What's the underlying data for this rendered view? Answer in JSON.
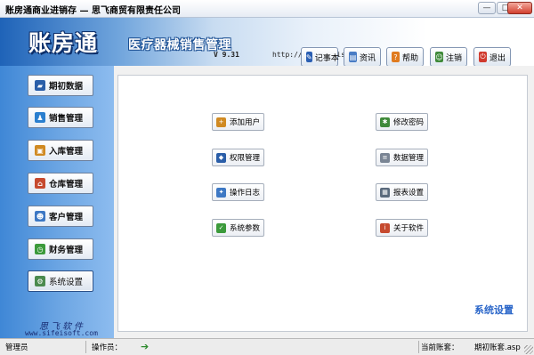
{
  "window": {
    "title": "账房通商业进销存 — 思飞商贸有限责任公司",
    "controls": {
      "minimize": "—",
      "maximize": "□",
      "close": "✕"
    }
  },
  "header": {
    "logo": "账房通",
    "subtitle": "医疗器械销售管理",
    "version": "V 9.31",
    "website": "http://www.sifeisoft.com",
    "toolbar": [
      {
        "label": "记事本",
        "icon": "notepad-icon",
        "color": "#2b5fb3"
      },
      {
        "label": "资讯",
        "icon": "news-icon",
        "color": "#4a7dc5"
      },
      {
        "label": "帮助",
        "icon": "help-icon",
        "color": "#e07b1f"
      },
      {
        "label": "注销",
        "icon": "logout-user-icon",
        "color": "#3f8a3a"
      },
      {
        "label": "退出",
        "icon": "exit-icon",
        "color": "#d03a2e"
      }
    ]
  },
  "sidebar": {
    "items": [
      {
        "label": "期初数据",
        "icon": "book-icon",
        "color": "#2a5ea8"
      },
      {
        "label": "销售管理",
        "icon": "sales-people-icon",
        "color": "#2a7fcf"
      },
      {
        "label": "入库管理",
        "icon": "box-icon",
        "color": "#d08a22"
      },
      {
        "label": "仓库管理",
        "icon": "warehouse-icon",
        "color": "#c64a2f"
      },
      {
        "label": "客户管理",
        "icon": "customer-icon",
        "color": "#3d78c4"
      },
      {
        "label": "财务管理",
        "icon": "clock-money-icon",
        "color": "#3b9a3b"
      },
      {
        "label": "系统设置",
        "icon": "system-settings-icon",
        "color": "#4b8a4e"
      }
    ],
    "signature_cn": "思飞软件",
    "signature_url": "www.sifeisoft.com"
  },
  "main": {
    "buttons": [
      {
        "label": "添加用户",
        "icon": "add-user-icon",
        "color": "#d08a22"
      },
      {
        "label": "修改密码",
        "icon": "password-icon",
        "color": "#3f8a3a"
      },
      {
        "label": "权限管理",
        "icon": "permission-icon",
        "color": "#2a5ea8"
      },
      {
        "label": "数据管理",
        "icon": "database-icon",
        "color": "#7a8594"
      },
      {
        "label": "操作日志",
        "icon": "log-icon",
        "color": "#3d78c4"
      },
      {
        "label": "报表设置",
        "icon": "report-icon",
        "color": "#5a6a7c"
      },
      {
        "label": "系统参数",
        "icon": "parameter-icon",
        "color": "#3b9a3b"
      },
      {
        "label": "关于软件",
        "icon": "about-icon",
        "color": "#c64a2f"
      }
    ],
    "section_tag": "系统设置"
  },
  "status": {
    "user": "管理员",
    "operator_label": "操作员：",
    "current_book_label": "当前账套：",
    "current_book_value": "期初账套.asp"
  }
}
